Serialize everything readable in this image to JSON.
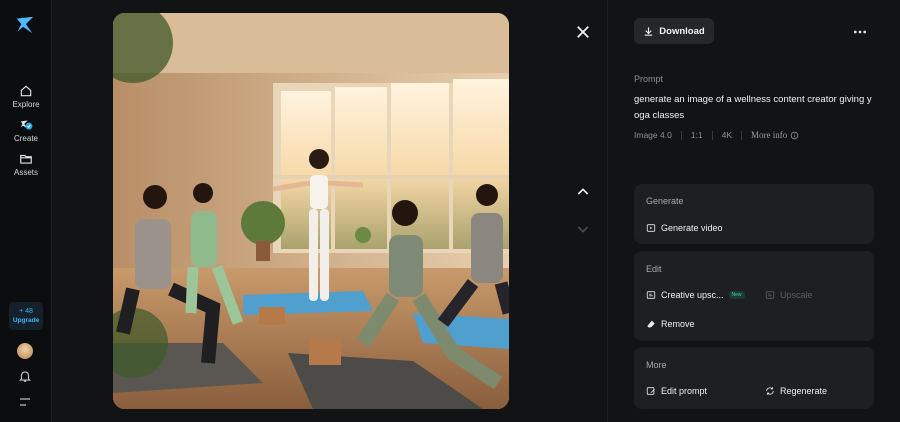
{
  "sidebar": {
    "items": [
      {
        "label": "Explore",
        "icon": "home-icon"
      },
      {
        "label": "Create",
        "icon": "create-icon"
      },
      {
        "label": "Assets",
        "icon": "folder-icon"
      }
    ],
    "upgrade_plus": "+ 48",
    "upgrade_label": "Upgrade"
  },
  "image": {
    "icon": "generated-image"
  },
  "toolbar": {
    "download_label": "Download"
  },
  "details": {
    "prompt_label": "Prompt",
    "prompt_text": "generate an image of a wellness content creator giving y oga classes",
    "model": "Image 4.0",
    "ratio": "1:1",
    "resolution": "4K",
    "more_info": "More info"
  },
  "cards": {
    "generate": {
      "title": "Generate",
      "video": "Generate video"
    },
    "edit": {
      "title": "Edit",
      "creative_upscale": "Creative upsc...",
      "new_badge": "New",
      "upscale": "Upscale",
      "remove": "Remove"
    },
    "more": {
      "title": "More",
      "edit_prompt": "Edit prompt",
      "regenerate": "Regenerate"
    }
  },
  "colors": {
    "accent": "#3fb5ff",
    "panel": "#1e1f23",
    "background": "#121315"
  }
}
